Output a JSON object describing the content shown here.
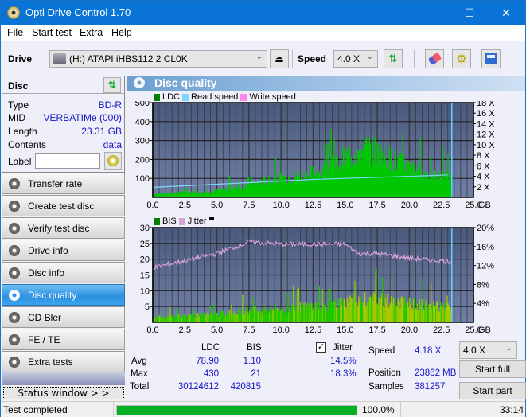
{
  "window": {
    "title": "Opti Drive Control 1.70",
    "minimize": "—",
    "maximize": "☐",
    "close": "✕"
  },
  "menu": [
    "File",
    "Start test",
    "Extra",
    "Help"
  ],
  "menu_underline": [
    "F",
    "S",
    "x",
    "H"
  ],
  "toolbar": {
    "drive_label": "Drive",
    "drive_value": "(H:)  ATAPI iHBS112  2 CL0K",
    "speed_label": "Speed",
    "speed_value": "4.0 X"
  },
  "disc": {
    "header": "Disc",
    "rows": [
      {
        "k": "Type",
        "v": "BD-R"
      },
      {
        "k": "MID",
        "v": "VERBATIMe (000)"
      },
      {
        "k": "Length",
        "v": "23.31 GB"
      },
      {
        "k": "Contents",
        "v": "data"
      }
    ],
    "label_key": "Label",
    "label_value": ""
  },
  "nav": [
    {
      "label": "Transfer rate",
      "active": false
    },
    {
      "label": "Create test disc",
      "active": false
    },
    {
      "label": "Verify test disc",
      "active": false
    },
    {
      "label": "Drive info",
      "active": false
    },
    {
      "label": "Disc info",
      "active": false
    },
    {
      "label": "Disc quality",
      "active": true
    },
    {
      "label": "CD Bler",
      "active": false
    },
    {
      "label": "FE / TE",
      "active": false
    },
    {
      "label": "Extra tests",
      "active": false
    }
  ],
  "status_window_btn": "Status window > >",
  "main": {
    "title": "Disc quality"
  },
  "colors": {
    "ldc": "#00c800",
    "read_speed": "#7fd4ff",
    "write_speed": "#ff88ee",
    "bis": "#00c800",
    "jitter": "#d8a0d8",
    "plot_bg_top": "#4a5a7e",
    "plot_bg_bottom": "#7080a8",
    "accent": "#0a74d6",
    "progress": "#06b025"
  },
  "chart_data": [
    {
      "type": "area",
      "title": "LDC",
      "legend": [
        "LDC",
        "Read speed",
        "Write speed"
      ],
      "xlabel": "GB",
      "xlim": [
        0,
        25
      ],
      "ylim_left": [
        0,
        500
      ],
      "ylim_right": [
        0,
        18
      ],
      "x_ticks": [
        "0.0",
        "2.5",
        "5.0",
        "7.5",
        "10.0",
        "12.5",
        "15.0",
        "17.5",
        "20.0",
        "22.5",
        "25.0"
      ],
      "y_ticks_left": [
        "500",
        "400",
        "300",
        "200",
        "100"
      ],
      "y_ticks_right": [
        "18 X",
        "16 X",
        "14 X",
        "12 X",
        "10 X",
        "8 X",
        "6 X",
        "4 X",
        "2 X"
      ],
      "end_marker_gb": 23.31,
      "series": [
        {
          "name": "LDC",
          "x": [
            0,
            1,
            2,
            3,
            4,
            5,
            6,
            7,
            7.5,
            8,
            9,
            10,
            11,
            12,
            13,
            14,
            15,
            16,
            16.5,
            17,
            18,
            19,
            20,
            21,
            22,
            22.5,
            23,
            23.3
          ],
          "values": [
            20,
            25,
            30,
            30,
            35,
            40,
            55,
            65,
            100,
            90,
            100,
            120,
            130,
            140,
            160,
            200,
            250,
            280,
            300,
            290,
            260,
            220,
            180,
            150,
            130,
            160,
            120,
            110
          ]
        },
        {
          "name": "Read speed",
          "x": [
            0,
            2.5,
            5,
            7.5,
            10,
            12.5,
            15,
            17.5,
            20,
            22.5,
            23.3
          ],
          "values": [
            1.9,
            2.2,
            2.5,
            2.8,
            3.1,
            3.4,
            3.6,
            3.8,
            4.0,
            4.2,
            4.3
          ]
        }
      ]
    },
    {
      "type": "area",
      "title": "BIS / Jitter",
      "legend": [
        "BIS",
        "Jitter"
      ],
      "xlabel": "GB",
      "xlim": [
        0,
        25
      ],
      "ylim_left": [
        0,
        30
      ],
      "ylim_right": [
        0,
        20
      ],
      "x_ticks": [
        "0.0",
        "2.5",
        "5.0",
        "7.5",
        "10.0",
        "12.5",
        "15.0",
        "17.5",
        "20.0",
        "22.5",
        "25.0"
      ],
      "y_ticks_left": [
        "30",
        "25",
        "20",
        "15",
        "10",
        "5"
      ],
      "y_ticks_right": [
        "20%",
        "16%",
        "12%",
        "8%",
        "4%"
      ],
      "end_marker_gb": 23.31,
      "series": [
        {
          "name": "BIS",
          "x": [
            0,
            2.5,
            5,
            7.5,
            10,
            12.5,
            15,
            16,
            17,
            18,
            20,
            22.5,
            23.3
          ],
          "values": [
            2,
            2.5,
            3,
            4.5,
            5,
            6,
            7,
            9,
            9,
            8,
            7,
            6,
            5
          ]
        },
        {
          "name": "Jitter",
          "x": [
            0,
            2.5,
            5,
            7.5,
            10,
            12.5,
            15,
            16,
            17.5,
            20,
            22.5,
            23.3
          ],
          "values": [
            11.5,
            13,
            14.5,
            17,
            16.5,
            16.5,
            16.5,
            14.5,
            14.5,
            13.5,
            13,
            12.8
          ]
        }
      ]
    }
  ],
  "stats": {
    "col_ldc": "LDC",
    "col_bis": "BIS",
    "avg_label": "Avg",
    "max_label": "Max",
    "total_label": "Total",
    "ldc_avg": "78.90",
    "bis_avg": "1.10",
    "ldc_max": "430",
    "bis_max": "21",
    "ldc_total": "30124612",
    "bis_total": "420815",
    "jitter_label": "Jitter",
    "jitter_checked": true,
    "jitter_avg": "14.5%",
    "jitter_max": "18.3%",
    "speed_label": "Speed",
    "speed_value": "4.18 X",
    "position_label": "Position",
    "position_value": "23862 MB",
    "samples_label": "Samples",
    "samples_value": "381257",
    "speed_select": "4.0 X",
    "start_full": "Start full",
    "start_part": "Start part"
  },
  "statusbar": {
    "text": "Test completed",
    "progress_pct": 100.0,
    "progress_text": "100.0%",
    "time": "33:14"
  }
}
